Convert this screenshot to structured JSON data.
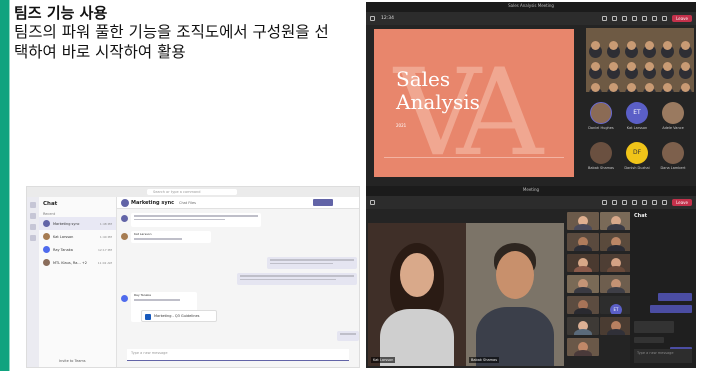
{
  "text": {
    "heading": "팀즈 기능 사용",
    "description": "팀즈의 파워 풀한 기능을 조직도에서 구성원을 선택하여 바로 시작하여 활용"
  },
  "colors": {
    "accent": "#10a37f",
    "teams_purple": "#6264a7",
    "leave_red": "#c4314b",
    "slide_coral": "#e8866c"
  },
  "meeting1": {
    "window_title": "Sales Analysis Meeting",
    "time": "12:34",
    "leave_label": "Leave",
    "slide_title_line1": "Sales",
    "slide_title_line2": "Analysis",
    "slide_big_letters": "VA",
    "slide_year": "2021",
    "participants": [
      "Daniel Hughes",
      "Kat Larsson",
      "Adele Vance",
      "Babak Shamas",
      "Danish Duzhai",
      "Dana Lambert"
    ],
    "initials": [
      "ET",
      "DF"
    ]
  },
  "chat_window": {
    "search_placeholder": "Search or type a command",
    "list_header": "Chat",
    "section_label": "Recent",
    "items": [
      {
        "name": "Marketing sync",
        "time": "1:48 PM"
      },
      {
        "name": "Kat Larsson",
        "time": "1:40 PM"
      },
      {
        "name": "Ray Tanaka",
        "time": "12:17 PM"
      },
      {
        "name": "MTL Klaus, Ra... +2",
        "time": "11:02 AM"
      }
    ],
    "group_name": "Marketing sync",
    "tabs": "Chat   Files",
    "sender_1": "Kat Larsson",
    "sender_2": "Ray Tanaka",
    "file_name": "Marketing - Q3 Guidelines",
    "compose_placeholder": "Type a new message",
    "bottom_label": "Invite to Teams"
  },
  "meeting2": {
    "window_title": "Meeting",
    "leave_label": "Leave",
    "speaker_1": "Kat Larsson",
    "speaker_2": "Babak Shamas",
    "initials": "ET",
    "chat_title": "Chat",
    "chat_box_placeholder": "Type a new message"
  }
}
